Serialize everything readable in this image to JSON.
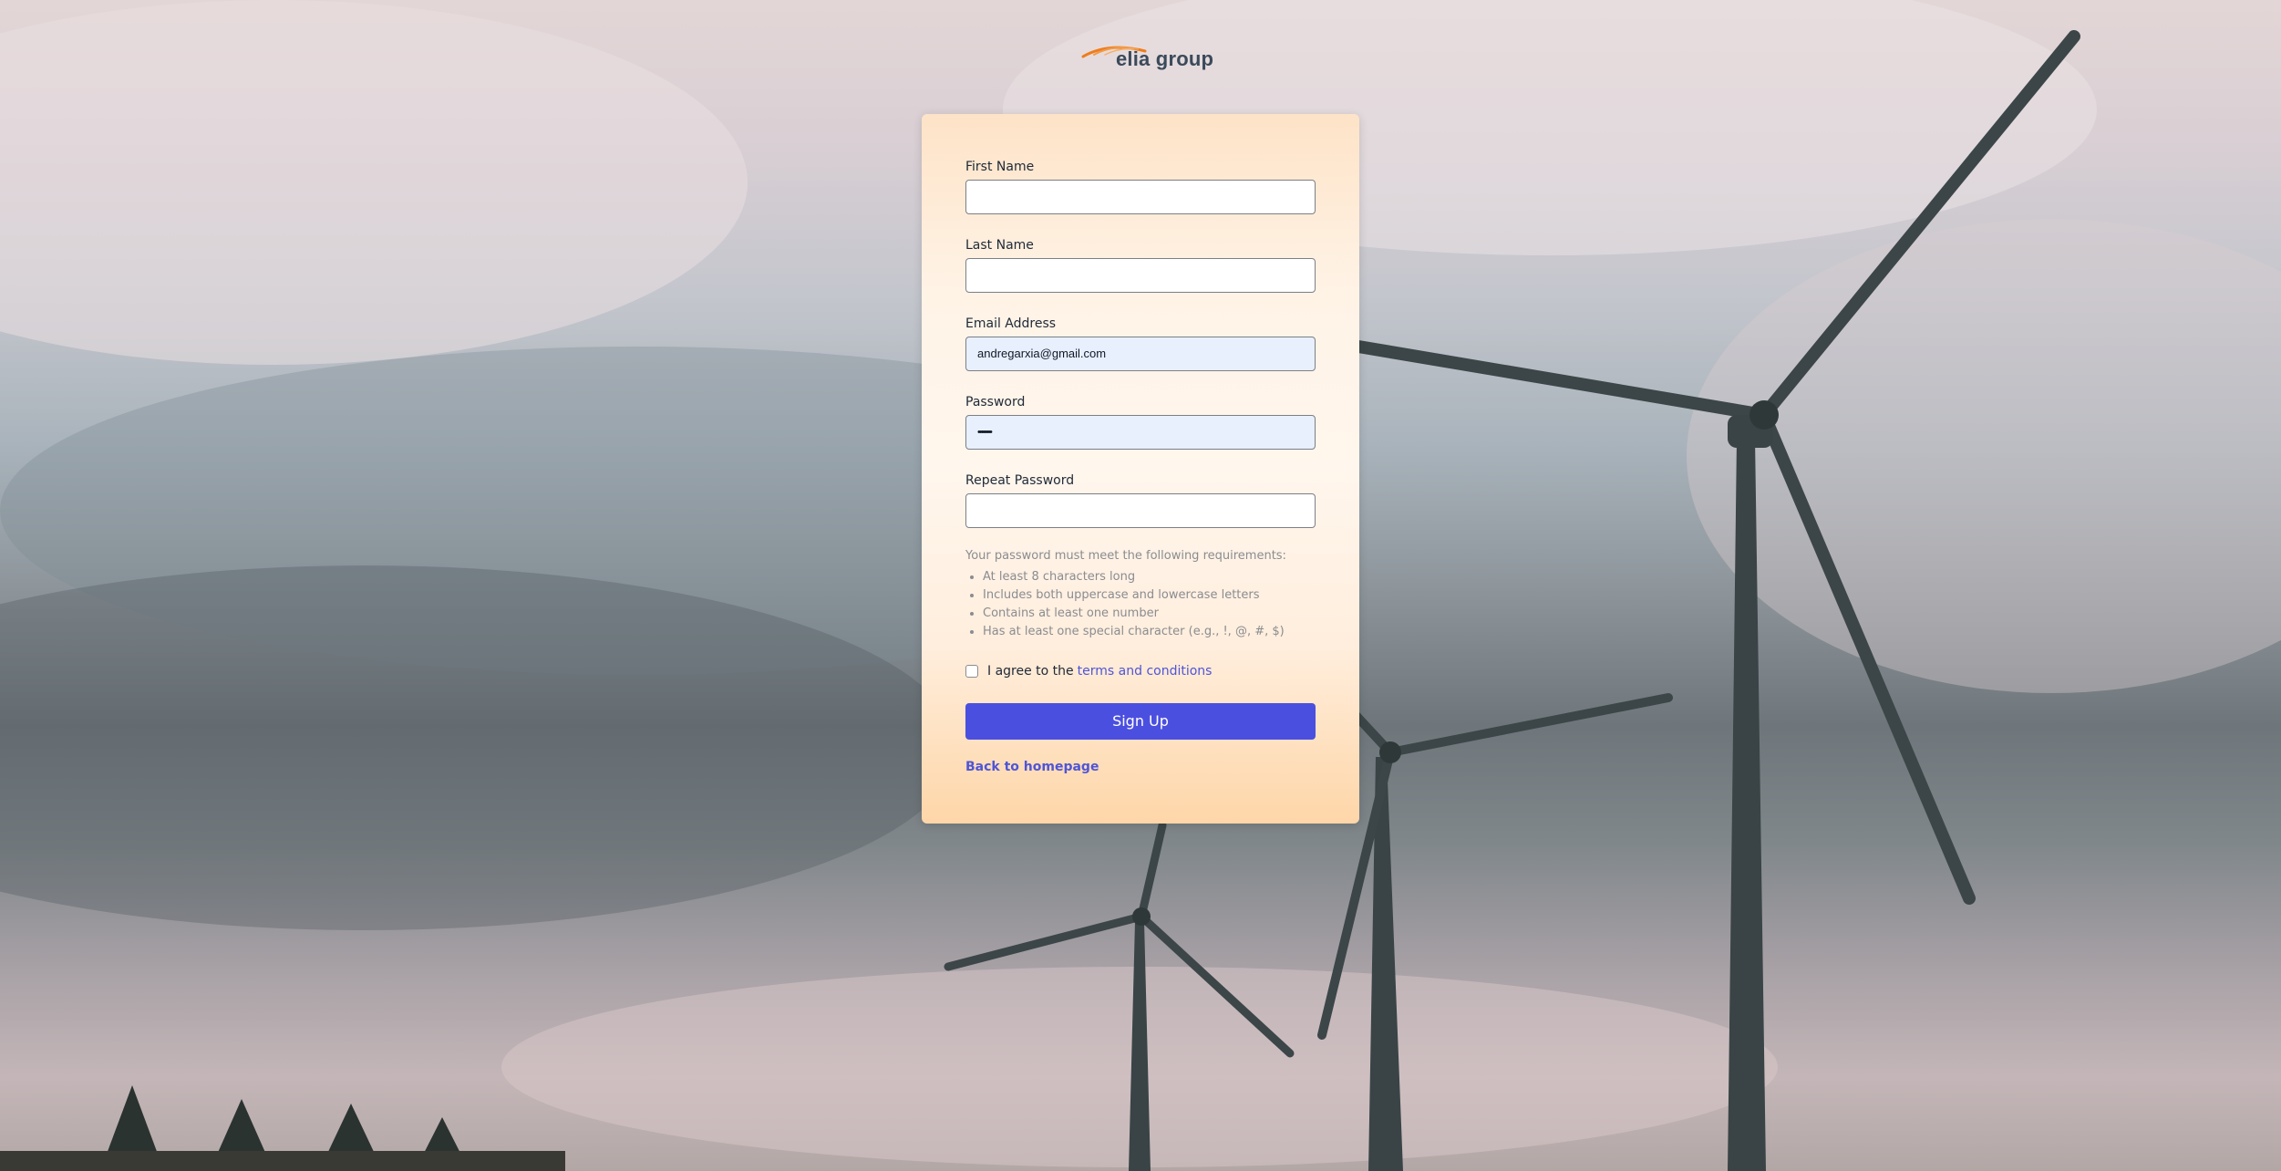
{
  "brand": {
    "logo_text": "elia group",
    "accent_color": "#f07c1b"
  },
  "form": {
    "first_name": {
      "label": "First Name",
      "value": ""
    },
    "last_name": {
      "label": "Last Name",
      "value": ""
    },
    "email": {
      "label": "Email Address",
      "value": "andregarxia@gmail.com"
    },
    "password": {
      "label": "Password",
      "value": "••••••••"
    },
    "repeat_password": {
      "label": "Repeat Password",
      "value": ""
    },
    "requirements": {
      "intro": "Your password must meet the following requirements:",
      "items": [
        "At least 8 characters long",
        "Includes both uppercase and lowercase letters",
        "Contains at least one number",
        "Has at least one special character (e.g., !, @, #, $)"
      ]
    },
    "terms": {
      "prefix": "I agree to the",
      "link_text": "terms and conditions",
      "checked": false
    },
    "submit_label": "Sign Up",
    "back_link": "Back to homepage",
    "button_color": "#4b4fe0"
  }
}
